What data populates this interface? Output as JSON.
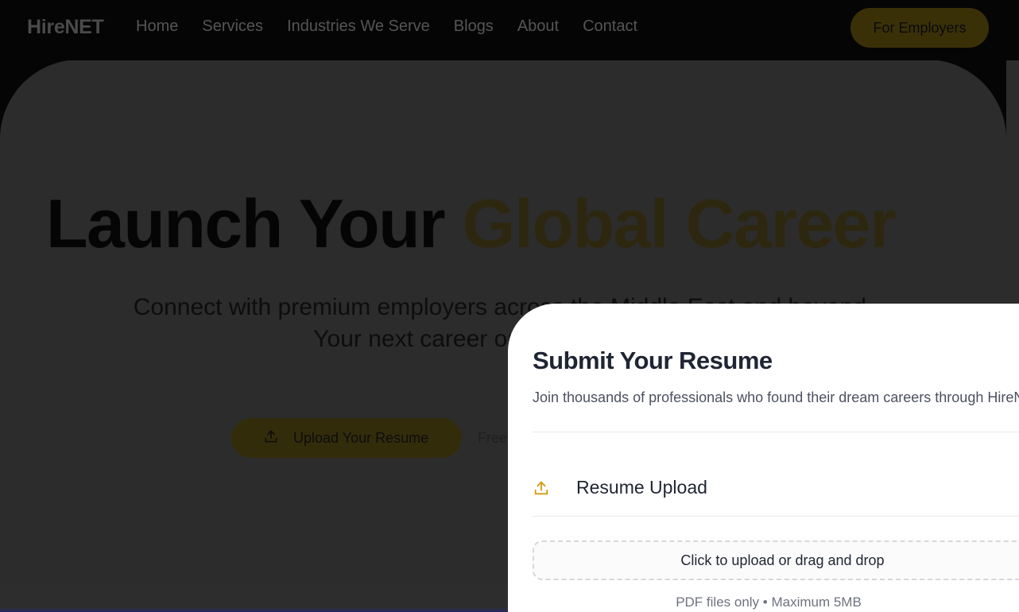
{
  "nav": {
    "logo": "HireNET",
    "links": [
      "Home",
      "Services",
      "Industries We Serve",
      "Blogs",
      "About",
      "Contact"
    ],
    "cta": "For Employers"
  },
  "hero": {
    "title_part1": "Launch Your",
    "title_accent": "Global Career",
    "subtitle_line1": "Connect with premium employers across the Middle East and beyond.",
    "subtitle_line2": "Your next career opportunity awaits.",
    "upload_button": "Upload Your Resume",
    "note": "Free"
  },
  "modal": {
    "title": "Submit Your Resume",
    "description": "Join thousands of professionals who found their dream careers through HireNET",
    "section_label": "Resume Upload",
    "dropzone_label": "Click to upload or drag and drop",
    "dropzone_hint": "PDF files only • Maximum 5MB"
  },
  "icons": {
    "upload": "upload-icon"
  },
  "colors": {
    "accent": "#d4a017",
    "modal_icon": "#d49a12",
    "heading": "#1f2533"
  }
}
